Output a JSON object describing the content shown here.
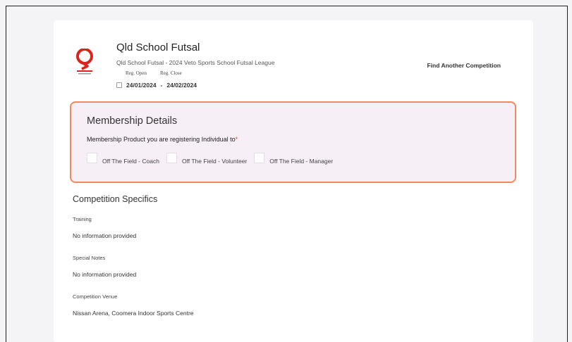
{
  "competition": {
    "title": "Qld School Futsal",
    "subtitle": "Qld School Futsal - 2024 Veto Sports School Futsal League",
    "reg_open_label": "Reg. Open",
    "reg_close_label": "Reg. Close",
    "reg_open_date": "24/01/2024",
    "reg_separator": "-",
    "reg_close_date": "24/02/2024",
    "find_another": "Find Another Competition"
  },
  "membership": {
    "title": "Membership Details",
    "question": "Membership Product you are registering Individual to",
    "required_mark": "*",
    "options": [
      {
        "label": "Off The Field - Coach",
        "checked": false
      },
      {
        "label": "Off The Field - Volunteer",
        "checked": false
      },
      {
        "label": "Off The Field - Manager",
        "checked": false
      }
    ]
  },
  "specifics": {
    "title": "Competition Specifics",
    "training_label": "Training",
    "training_value": "No information provided",
    "notes_label": "Special Notes",
    "notes_value": "No information provided",
    "venue_label": "Competition Venue",
    "venue_value": "Nissan Arena, Coomera Indoor Sports Centre"
  },
  "colors": {
    "membership_border": "#f08a5d",
    "membership_bg": "#f6eff6",
    "required": "#e43d30",
    "logo_red": "#d9251c"
  },
  "icons": {
    "logo": "qld-school-futsal-logo",
    "calendar": "calendar-icon"
  }
}
